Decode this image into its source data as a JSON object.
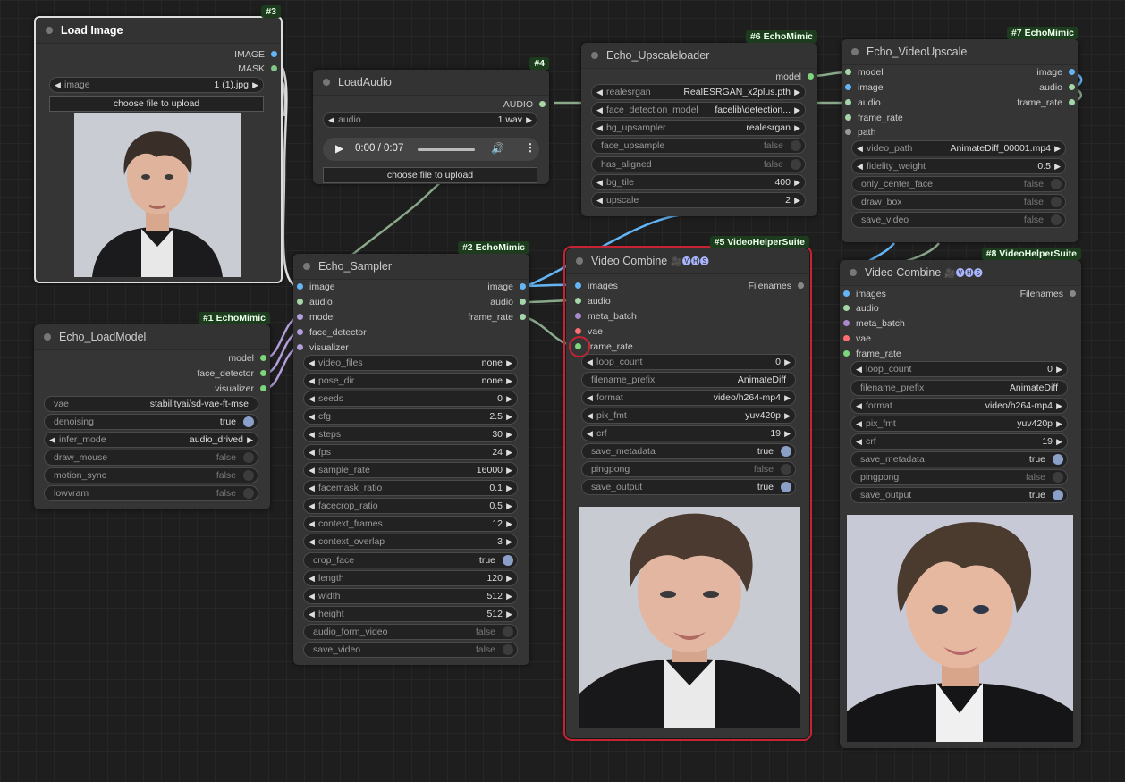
{
  "colors": {
    "image": "#64b5f6",
    "mask": "#81c784",
    "audio": "#a5d6a7",
    "model": "#b39ddb",
    "green": "#7cd67c",
    "purple": "#b39ddb",
    "vae": "#ff6e6e",
    "meta": "#aa88cc",
    "plain": "#999999",
    "selected_outline": "#c82333"
  },
  "node3": {
    "badge": "#3",
    "title": "Load Image",
    "out_image": "IMAGE",
    "out_mask": "MASK",
    "image_label": "image",
    "image_value": "1 (1).jpg",
    "upload": "choose file to upload"
  },
  "node4": {
    "badge": "#4",
    "title": "LoadAudio",
    "out_audio": "AUDIO",
    "audio_label": "audio",
    "audio_value": "1.wav",
    "time": "0:00 / 0:07",
    "upload": "choose file to upload"
  },
  "node1": {
    "badge": "#1 EchoMimic",
    "title": "Echo_LoadModel",
    "outputs": [
      "model",
      "face_detector",
      "visualizer"
    ],
    "widgets": [
      {
        "label": "vae",
        "value": "stabilityai/sd-vae-ft-mse"
      },
      {
        "label": "denoising",
        "value": "true"
      },
      {
        "label": "infer_mode",
        "value": "audio_drived"
      },
      {
        "label": "draw_mouse",
        "value": "false"
      },
      {
        "label": "motion_sync",
        "value": "false"
      },
      {
        "label": "lowvram",
        "value": "false"
      }
    ]
  },
  "node2": {
    "badge": "#2 EchoMimic",
    "title": "Echo_Sampler",
    "inputs": [
      "image",
      "audio",
      "model",
      "face_detector",
      "visualizer"
    ],
    "outputs": [
      "image",
      "audio",
      "frame_rate"
    ],
    "widgets": [
      {
        "label": "video_files",
        "value": "none"
      },
      {
        "label": "pose_dir",
        "value": "none"
      },
      {
        "label": "seeds",
        "value": "0"
      },
      {
        "label": "cfg",
        "value": "2.5"
      },
      {
        "label": "steps",
        "value": "30"
      },
      {
        "label": "fps",
        "value": "24"
      },
      {
        "label": "sample_rate",
        "value": "16000"
      },
      {
        "label": "facemask_ratio",
        "value": "0.1"
      },
      {
        "label": "facecrop_ratio",
        "value": "0.5"
      },
      {
        "label": "context_frames",
        "value": "12"
      },
      {
        "label": "context_overlap",
        "value": "3"
      },
      {
        "label": "crop_face",
        "value": "true"
      },
      {
        "label": "length",
        "value": "120"
      },
      {
        "label": "width",
        "value": "512"
      },
      {
        "label": "height",
        "value": "512"
      },
      {
        "label": "audio_form_video",
        "value": "false"
      },
      {
        "label": "save_video",
        "value": "false"
      }
    ]
  },
  "node6": {
    "badge": "#6 EchoMimic",
    "title": "Echo_Upscaleloader",
    "out_model": "model",
    "widgets": [
      {
        "label": "realesrgan",
        "value": "RealESRGAN_x2plus.pth"
      },
      {
        "label": "face_detection_model",
        "value": "facelib\\detection..."
      },
      {
        "label": "bg_upsampler",
        "value": "realesrgan"
      },
      {
        "label": "face_upsample",
        "value": "false"
      },
      {
        "label": "has_aligned",
        "value": "false"
      },
      {
        "label": "bg_tile",
        "value": "400"
      },
      {
        "label": "upscale",
        "value": "2"
      }
    ]
  },
  "node7": {
    "badge": "#7 EchoMimic",
    "title": "Echo_VideoUpscale",
    "inputs": [
      "model",
      "image",
      "audio",
      "frame_rate",
      "path"
    ],
    "outputs": [
      "image",
      "audio",
      "frame_rate"
    ],
    "widgets": [
      {
        "label": "video_path",
        "value": "AnimateDiff_00001.mp4"
      },
      {
        "label": "fidelity_weight",
        "value": "0.5"
      },
      {
        "label": "only_center_face",
        "value": "false"
      },
      {
        "label": "draw_box",
        "value": "false"
      },
      {
        "label": "save_video",
        "value": "false"
      }
    ]
  },
  "node5": {
    "badge": "#5 VideoHelperSuite",
    "title": "Video Combine",
    "suffix": "🎥🅥🅗🅢",
    "out": "Filenames",
    "inputs": [
      "images",
      "audio",
      "meta_batch",
      "vae",
      "frame_rate"
    ],
    "widgets": [
      {
        "label": "loop_count",
        "value": "0"
      },
      {
        "label": "filename_prefix",
        "value": "AnimateDiff"
      },
      {
        "label": "format",
        "value": "video/h264-mp4"
      },
      {
        "label": "pix_fmt",
        "value": "yuv420p"
      },
      {
        "label": "crf",
        "value": "19"
      },
      {
        "label": "save_metadata",
        "value": "true"
      },
      {
        "label": "pingpong",
        "value": "false"
      },
      {
        "label": "save_output",
        "value": "true"
      }
    ]
  },
  "node8": {
    "badge": "#8 VideoHelperSuite",
    "title": "Video Combine",
    "suffix": "🎥🅥🅗🅢",
    "out": "Filenames",
    "inputs": [
      "images",
      "audio",
      "meta_batch",
      "vae",
      "frame_rate"
    ],
    "widgets": [
      {
        "label": "loop_count",
        "value": "0"
      },
      {
        "label": "filename_prefix",
        "value": "AnimateDiff"
      },
      {
        "label": "format",
        "value": "video/h264-mp4"
      },
      {
        "label": "pix_fmt",
        "value": "yuv420p"
      },
      {
        "label": "crf",
        "value": "19"
      },
      {
        "label": "save_metadata",
        "value": "true"
      },
      {
        "label": "pingpong",
        "value": "false"
      },
      {
        "label": "save_output",
        "value": "true"
      }
    ]
  }
}
